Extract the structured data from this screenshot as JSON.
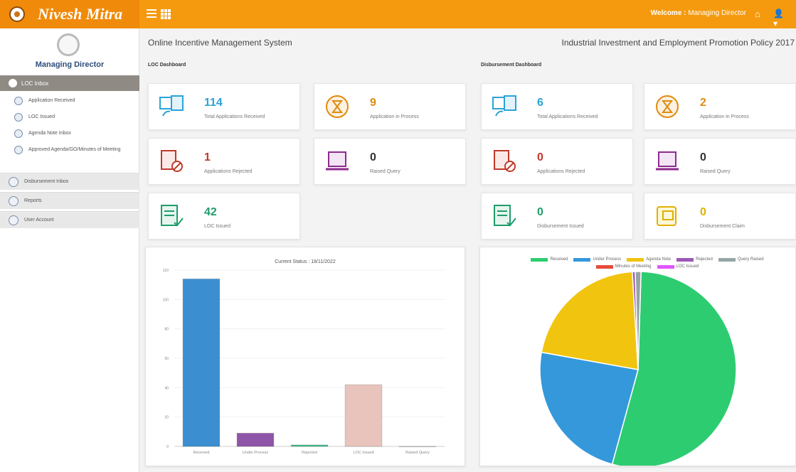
{
  "header": {
    "brand": "Nivesh Mitra",
    "welcome_prefix": "Welcome :",
    "welcome_user": "Managing Director"
  },
  "sidebar": {
    "role": "Managing Director",
    "loc_inbox": "LOC Inbox",
    "items": [
      {
        "label": "Application Received"
      },
      {
        "label": "LOC Issued"
      },
      {
        "label": "Agenda Note Inbox"
      },
      {
        "label": "Approved Agenda/GO/Minutes of Meeting"
      }
    ],
    "main": [
      {
        "label": "Disbursement Inbox"
      },
      {
        "label": "Reports"
      },
      {
        "label": "User Account"
      }
    ]
  },
  "main": {
    "title": "Online Incentive Management System",
    "policy": "Industrial Investment and Employment Promotion Policy 2017",
    "loc_label": "LOC Dashboard",
    "disb_label": "Disbursement Dashboard"
  },
  "loc_cards": [
    {
      "value": "114",
      "label": "Total Applications Received",
      "color": "#2aa3d8"
    },
    {
      "value": "9",
      "label": "Application in Process",
      "color": "#e08a10"
    },
    {
      "value": "1",
      "label": "Applications Rejected",
      "color": "#c0392b"
    },
    {
      "value": "0",
      "label": "Raised Query",
      "color": "#333333"
    },
    {
      "value": "42",
      "label": "LOC Issued",
      "color": "#1f9d6b"
    }
  ],
  "disb_cards": [
    {
      "value": "6",
      "label": "Total Applications Received",
      "color": "#2aa3d8"
    },
    {
      "value": "2",
      "label": "Application in Process",
      "color": "#e08a10"
    },
    {
      "value": "0",
      "label": "Applications Rejected",
      "color": "#c0392b"
    },
    {
      "value": "0",
      "label": "Raised Query",
      "color": "#333333"
    },
    {
      "value": "0",
      "label": "Disbursement Issued",
      "color": "#1f9d6b"
    },
    {
      "value": "0",
      "label": "Disbursement Claim",
      "color": "#e0b000"
    }
  ],
  "chart_data": [
    {
      "type": "bar",
      "title": "Current Status : 18/11/2022",
      "categories": [
        "Received",
        "Under Process",
        "Rejected",
        "LOC Issued",
        "Raised Query"
      ],
      "values": [
        114,
        9,
        1,
        42,
        0
      ],
      "colors": [
        "#3b8fd0",
        "#8f55a8",
        "#3fbf8a",
        "#e8c4bc",
        "#999999"
      ],
      "ylim": [
        0,
        120
      ],
      "yticks": [
        0,
        20,
        40,
        60,
        80,
        100,
        120
      ]
    },
    {
      "type": "pie",
      "legend": [
        {
          "name": "Received",
          "color": "#2ecc71"
        },
        {
          "name": "Under Process",
          "color": "#3498db"
        },
        {
          "name": "Agenda Note",
          "color": "#f1c40f"
        },
        {
          "name": "Rejected",
          "color": "#9b59b6"
        },
        {
          "name": "Query Raised",
          "color": "#95a5a6"
        },
        {
          "name": "Minutes of Meeting",
          "color": "#e74c3c"
        },
        {
          "name": "LOC Issued",
          "color": "#e056fd"
        }
      ],
      "values": [
        114,
        50,
        45,
        1,
        2,
        0,
        0
      ]
    }
  ]
}
